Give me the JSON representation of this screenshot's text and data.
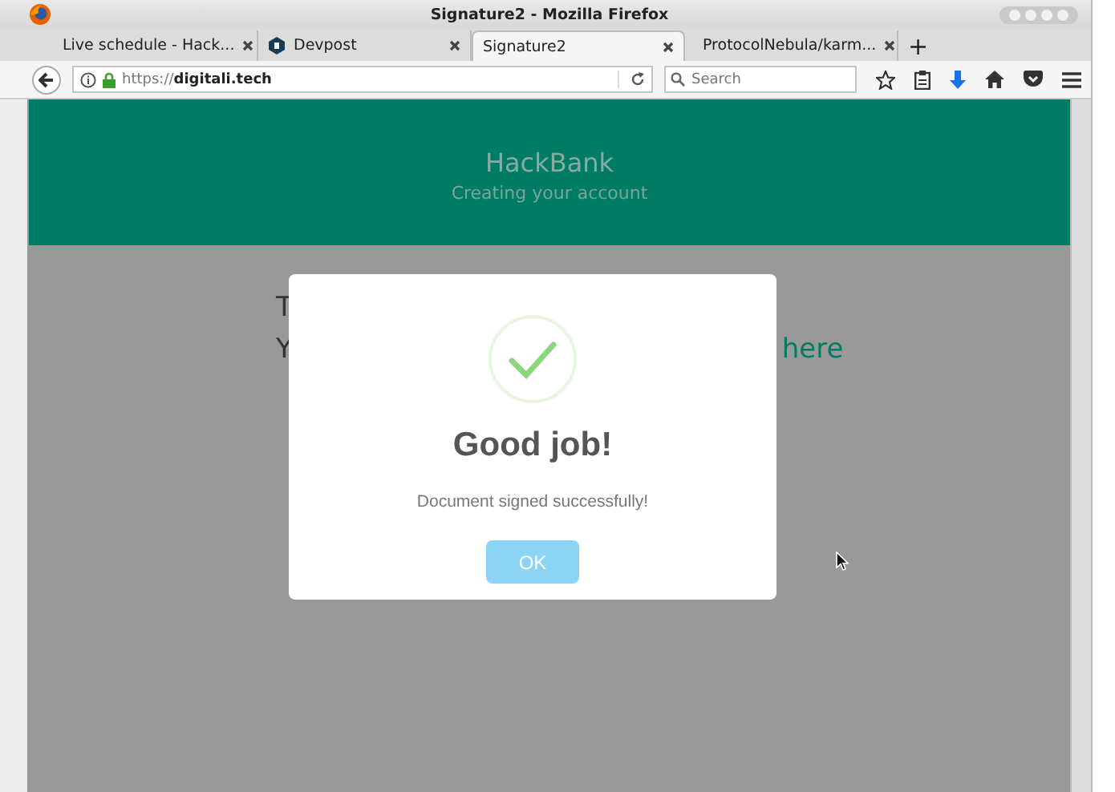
{
  "window": {
    "title": "Signature2 - Mozilla Firefox"
  },
  "tabs": [
    {
      "label": "Live schedule - Hack...",
      "selected": false
    },
    {
      "label": "Devpost",
      "selected": false
    },
    {
      "label": "Signature2",
      "selected": true
    },
    {
      "label": "ProtocolNebula/karm...",
      "selected": false
    }
  ],
  "new_tab": "+",
  "address": {
    "prefix": "https://",
    "host": "digitali.tech"
  },
  "search": {
    "placeholder": "Search"
  },
  "header": {
    "title": "HackBank",
    "subtitle": "Creating your account"
  },
  "behind": {
    "line_1": "T",
    "line_2": "Y",
    "link": "here"
  },
  "dialog": {
    "title": "Good job!",
    "message": "Document signed successfully!",
    "button": "OK"
  }
}
